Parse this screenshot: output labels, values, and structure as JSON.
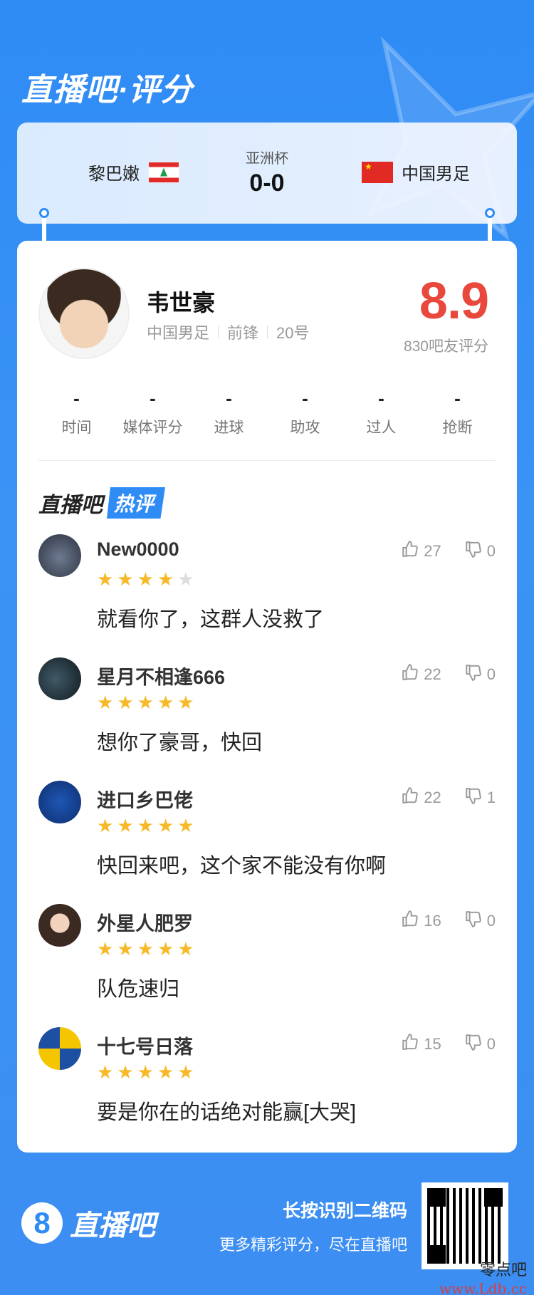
{
  "brand": {
    "title": "直播吧·评分"
  },
  "match": {
    "competition": "亚洲杯",
    "score": "0-0",
    "home_team": "黎巴嫩",
    "away_team": "中国男足"
  },
  "player": {
    "name": "韦世豪",
    "team": "中国男足",
    "position": "前锋",
    "number": "20号",
    "rating": "8.9",
    "rating_count": "830吧友评分"
  },
  "stats": [
    {
      "value": "-",
      "label": "时间"
    },
    {
      "value": "-",
      "label": "媒体评分"
    },
    {
      "value": "-",
      "label": "进球"
    },
    {
      "value": "-",
      "label": "助攻"
    },
    {
      "value": "-",
      "label": "过人"
    },
    {
      "value": "-",
      "label": "抢断"
    }
  ],
  "hot": {
    "main": "直播吧",
    "tag": "热评"
  },
  "comments": [
    {
      "user": "New0000",
      "stars": 4,
      "text": "就看你了，这群人没救了",
      "likes": "27",
      "dislikes": "0"
    },
    {
      "user": "星月不相逢666",
      "stars": 5,
      "text": "想你了豪哥，快回",
      "likes": "22",
      "dislikes": "0"
    },
    {
      "user": "进口乡巴佬",
      "stars": 5,
      "text": "快回来吧，这个家不能没有你啊",
      "likes": "22",
      "dislikes": "1"
    },
    {
      "user": "外星人肥罗",
      "stars": 5,
      "text": "队危速归",
      "likes": "16",
      "dislikes": "0"
    },
    {
      "user": "十七号日落",
      "stars": 5,
      "text": "要是你在的话绝对能赢[大哭]",
      "likes": "15",
      "dislikes": "0"
    }
  ],
  "footer": {
    "logo_char": "8",
    "logo_text": "直播吧",
    "cta_line1": "长按识别二维码",
    "cta_line2": "更多精彩评分，尽在直播吧"
  },
  "watermark": {
    "line1": "零点吧",
    "line2": "www.Ldb.cc"
  },
  "colors": {
    "primary": "#2f8cf5",
    "rating": "#e8493c",
    "star": "#f7b928"
  }
}
